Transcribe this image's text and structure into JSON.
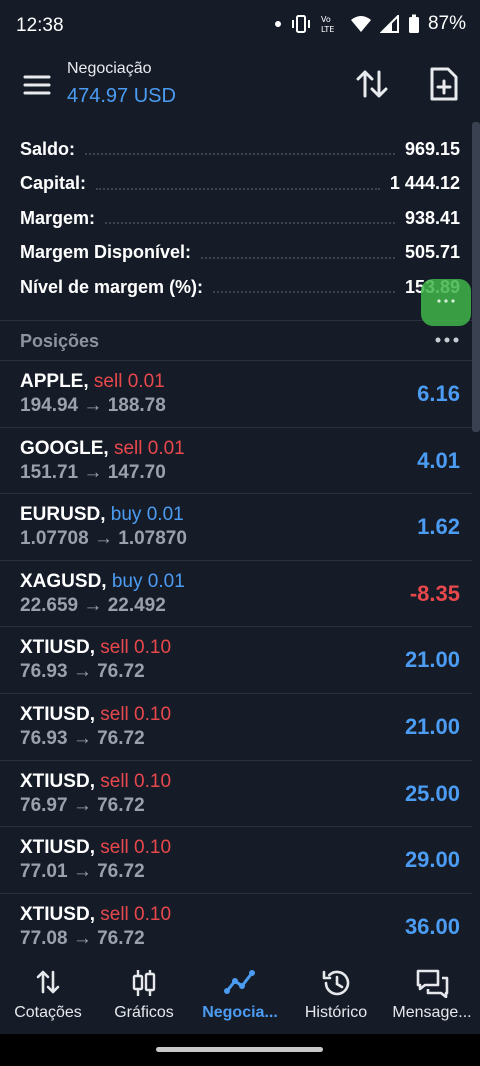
{
  "status_bar": {
    "time": "12:38",
    "battery": "87%",
    "lte_label": "Vo LTE"
  },
  "header": {
    "title": "Negociação",
    "balance": "474.97 USD",
    "icons": [
      "menu-icon",
      "sort-icon",
      "new-document-icon"
    ]
  },
  "summary": [
    {
      "label": "Saldo:",
      "value": "969.15"
    },
    {
      "label": "Capital:",
      "value": "1 444.12"
    },
    {
      "label": "Margem:",
      "value": "938.41"
    },
    {
      "label": "Margem Disponível:",
      "value": "505.71"
    },
    {
      "label": "Nível de margem (%):",
      "value": "153.89"
    }
  ],
  "positions": {
    "title": "Posições",
    "items": [
      {
        "symbol": "APPLE",
        "side": "sell",
        "volume": "0.01",
        "open": "194.94",
        "current": "188.78",
        "profit": "6.16"
      },
      {
        "symbol": "GOOGLE",
        "side": "sell",
        "volume": "0.01",
        "open": "151.71",
        "current": "147.70",
        "profit": "4.01"
      },
      {
        "symbol": "EURUSD",
        "side": "buy",
        "volume": "0.01",
        "open": "1.07708",
        "current": "1.07870",
        "profit": "1.62"
      },
      {
        "symbol": "XAGUSD",
        "side": "buy",
        "volume": "0.01",
        "open": "22.659",
        "current": "22.492",
        "profit": "-8.35"
      },
      {
        "symbol": "XTIUSD",
        "side": "sell",
        "volume": "0.10",
        "open": "76.93",
        "current": "76.72",
        "profit": "21.00"
      },
      {
        "symbol": "XTIUSD",
        "side": "sell",
        "volume": "0.10",
        "open": "76.93",
        "current": "76.72",
        "profit": "21.00"
      },
      {
        "symbol": "XTIUSD",
        "side": "sell",
        "volume": "0.10",
        "open": "76.97",
        "current": "76.72",
        "profit": "25.00"
      },
      {
        "symbol": "XTIUSD",
        "side": "sell",
        "volume": "0.10",
        "open": "77.01",
        "current": "76.72",
        "profit": "29.00"
      },
      {
        "symbol": "XTIUSD",
        "side": "sell",
        "volume": "0.10",
        "open": "77.08",
        "current": "76.72",
        "profit": "36.00"
      }
    ]
  },
  "nav": [
    {
      "label": "Cotações",
      "icon": "quotes-arrows-icon",
      "active": false
    },
    {
      "label": "Gráficos",
      "icon": "candlestick-icon",
      "active": false
    },
    {
      "label": "Negocia...",
      "icon": "trade-chart-icon",
      "active": true
    },
    {
      "label": "Histórico",
      "icon": "history-icon",
      "active": false
    },
    {
      "label": "Mensage...",
      "icon": "messages-icon",
      "active": false
    }
  ],
  "colors": {
    "background": "#151c28",
    "accent_blue": "#4b9cf2",
    "sell_red": "#e8484c",
    "muted_text": "#9aa1ac",
    "bubble_green": "#40b448"
  }
}
